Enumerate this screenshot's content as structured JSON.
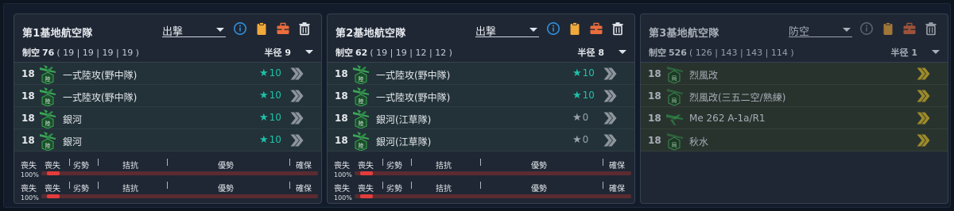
{
  "colors": {
    "accent": "#2f8fdc",
    "star": "#1fc0a8",
    "gauge_fill": "#e23c3c",
    "yellow_chevron": "#9c8a2a"
  },
  "icons": {
    "info": "info-icon",
    "clipboard": "clipboard-icon",
    "toolbox": "toolbox-icon",
    "trash": "trash-icon",
    "plane": "bomber-plane-icon",
    "chevron": "double-chevron-icon",
    "star": "star-icon"
  },
  "panels": [
    {
      "title": "第1基地航空隊",
      "mode": "出撃",
      "air_label": "制空",
      "air_value": "76",
      "air_detail": "( 19 | 19 | 19 | 19 )",
      "radius_label": "半径",
      "radius_value": "9",
      "slots": [
        {
          "count": "18",
          "name": "一式陸攻(野中隊)",
          "star": "10"
        },
        {
          "count": "18",
          "name": "一式陸攻(野中隊)",
          "star": "10"
        },
        {
          "count": "18",
          "name": "銀河",
          "star": "10"
        },
        {
          "count": "18",
          "name": "銀河",
          "star": "10"
        }
      ],
      "gauges": [
        {
          "label": "喪失",
          "pct": "100%",
          "scale": [
            "喪失",
            "劣勢",
            "拮抗",
            "優勢",
            "確保"
          ]
        },
        {
          "label": "喪失",
          "pct": "100%",
          "scale": [
            "喪失",
            "劣勢",
            "拮抗",
            "優勢",
            "確保"
          ]
        }
      ]
    },
    {
      "title": "第2基地航空隊",
      "mode": "出撃",
      "air_label": "制空",
      "air_value": "62",
      "air_detail": "( 19 | 19 | 12 | 12 )",
      "radius_label": "半径",
      "radius_value": "8",
      "slots": [
        {
          "count": "18",
          "name": "一式陸攻(野中隊)",
          "star": "10"
        },
        {
          "count": "18",
          "name": "一式陸攻(野中隊)",
          "star": "10"
        },
        {
          "count": "18",
          "name": "銀河(江草隊)",
          "star": "0"
        },
        {
          "count": "18",
          "name": "銀河(江草隊)",
          "star": "0"
        }
      ],
      "gauges": [
        {
          "label": "喪失",
          "pct": "100%",
          "scale": [
            "喪失",
            "劣勢",
            "拮抗",
            "優勢",
            "確保"
          ]
        },
        {
          "label": "喪失",
          "pct": "100%",
          "scale": [
            "喪失",
            "劣勢",
            "拮抗",
            "優勢",
            "確保"
          ]
        }
      ]
    },
    {
      "title": "第3基地航空隊",
      "mode": "防空",
      "air_label": "制空",
      "air_value": "526",
      "air_detail": "( 126 | 143 | 143 | 114 )",
      "radius_label": "半径",
      "radius_value": "1",
      "slots": [
        {
          "count": "18",
          "name": "烈風改"
        },
        {
          "count": "18",
          "name": "烈風改(三五二空/熟練)"
        },
        {
          "count": "18",
          "name": "Me 262 A-1a/R1"
        },
        {
          "count": "18",
          "name": "秋水"
        }
      ]
    }
  ]
}
